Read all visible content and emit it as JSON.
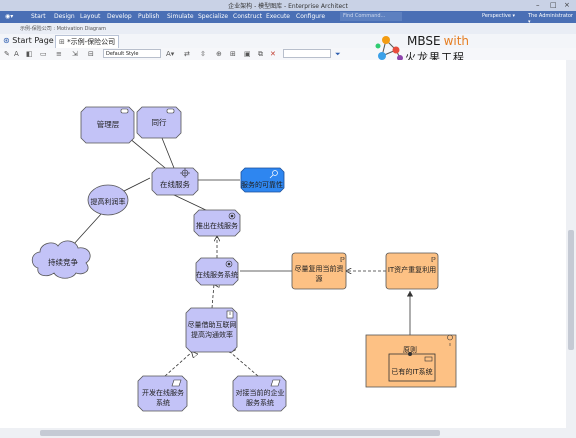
{
  "window": {
    "title": "企业架构 - 模型图库 - Enterprise Architect",
    "controls": [
      "–",
      "□",
      "×"
    ]
  },
  "menu": {
    "items": [
      "Start",
      "Design",
      "Layout",
      "Develop",
      "Publish",
      "Simulate",
      "Specialize",
      "Construct",
      "Execute",
      "Configure"
    ],
    "find_placeholder": "Find Command...",
    "perspective": "Perspective ▾",
    "user": "The Administrator ▾"
  },
  "breadcrumb": "示例-保险公司 : Motivation Diagram",
  "tabs": [
    {
      "label": "Start Page",
      "active": false
    },
    {
      "label": "*示例-保险公司",
      "active": true
    }
  ],
  "toolbar": {
    "style_select": "Default Style"
  },
  "logo": {
    "brand": "MBSE",
    "with": "with",
    "subtitle": "火龙果工程"
  },
  "diagram": {
    "nodes": [
      {
        "id": "guanli",
        "label": "管理层"
      },
      {
        "id": "tonghang",
        "label": "同行"
      },
      {
        "id": "zaixian",
        "label": "在线服务"
      },
      {
        "id": "kexindu",
        "label": "服务的可靠性"
      },
      {
        "id": "tigao",
        "label": "提高利润率"
      },
      {
        "id": "chixu",
        "label": "持续竞争"
      },
      {
        "id": "tuichu",
        "label": "推出在线服务"
      },
      {
        "id": "xitong",
        "label": "在线服务系统"
      },
      {
        "id": "jinliang",
        "label": "尽量借助互联网提高沟通效率"
      },
      {
        "id": "fuyong",
        "label": "尽量复用当前资源"
      },
      {
        "id": "itzichan",
        "label": "IT资产重复利用"
      },
      {
        "id": "kaifa",
        "label": "开发在线服务系统"
      },
      {
        "id": "duijie",
        "label": "对接当前的企业服务系统"
      },
      {
        "id": "yuanze",
        "label": "原则"
      },
      {
        "id": "yiyou",
        "label": "已有的IT系统"
      }
    ]
  },
  "colors": {
    "stakeholder": "#c3c3f7",
    "goal_blue": "#2e86f0",
    "orange": "#fdc184",
    "accent_menu": "#4a6fb5"
  }
}
